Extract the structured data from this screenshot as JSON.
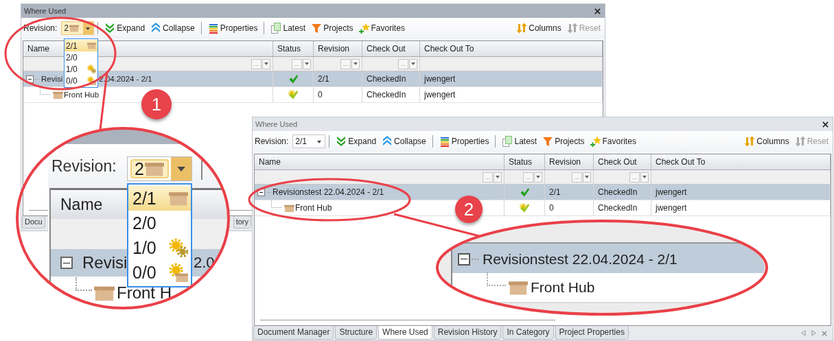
{
  "windows": [
    {
      "title": "Where Used",
      "active": true,
      "toolbar": {
        "revision_label": "Revision:",
        "combo": {
          "value": "2",
          "kind": "box",
          "open": true,
          "options": [
            {
              "label": "2/1",
              "kind": "box",
              "selected": true
            },
            {
              "label": "2/0",
              "kind": "plain",
              "selected": false
            },
            {
              "label": "1/0",
              "kind": "gear",
              "selected": false
            },
            {
              "label": "0/0",
              "kind": "gear-box",
              "selected": false
            }
          ]
        },
        "groups": [
          [
            {
              "label": "Expand",
              "kind": "expand",
              "disabled": false
            },
            {
              "label": "Collapse",
              "kind": "collapse",
              "disabled": false
            }
          ],
          [
            {
              "label": "Properties",
              "kind": "properties",
              "disabled": false
            }
          ],
          [
            {
              "label": "Latest",
              "kind": "latest",
              "disabled": false
            },
            {
              "label": "Projects",
              "kind": "projects",
              "disabled": false
            },
            {
              "label": "Favorites",
              "kind": "favorites",
              "disabled": false
            }
          ]
        ],
        "right": [
          {
            "label": "Columns",
            "kind": "columns",
            "disabled": false
          },
          {
            "label": "Reset",
            "kind": "reset",
            "disabled": true
          }
        ]
      },
      "columns": [
        {
          "label": "Name",
          "filter": "..."
        },
        {
          "label": "Status",
          "filter": "..."
        },
        {
          "label": "Revision",
          "filter": "..."
        },
        {
          "label": "Check Out",
          "filter": "..."
        },
        {
          "label": "Check Out To"
        }
      ],
      "rows": [
        {
          "name_parts": [
            "Revisi",
            "2.04.2024 - 2/1"
          ],
          "expanded": true,
          "selected": true,
          "status": {
            "kind": "ok"
          },
          "revision": "2/1",
          "check_out": "CheckedIn",
          "check_out_to": "jwengert",
          "children": [
            {
              "name_parts": [
                "Front Hub"
              ],
              "selected": false,
              "status": {
                "kind": "ok-gear"
              },
              "revision": "0",
              "check_out": "CheckedIn",
              "check_out_to": "jwengert"
            }
          ]
        }
      ],
      "tabs": [
        {
          "label": "Docu",
          "selected": false
        },
        {
          "label": "tory",
          "selected": false
        }
      ]
    },
    {
      "title": "Where Used",
      "active": false,
      "toolbar": {
        "revision_label": "Revision:",
        "combo": {
          "value": "2/1",
          "kind": "plain",
          "open": false
        },
        "groups": [
          [
            {
              "label": "Expand",
              "kind": "expand",
              "disabled": false
            },
            {
              "label": "Collapse",
              "kind": "collapse",
              "disabled": false
            }
          ],
          [
            {
              "label": "Properties",
              "kind": "properties",
              "disabled": false
            }
          ],
          [
            {
              "label": "Latest",
              "kind": "latest",
              "disabled": false
            },
            {
              "label": "Projects",
              "kind": "projects",
              "disabled": false
            },
            {
              "label": "Favorites",
              "kind": "favorites",
              "disabled": false
            }
          ]
        ],
        "right": [
          {
            "label": "Columns",
            "kind": "columns",
            "disabled": false
          },
          {
            "label": "Reset",
            "kind": "reset",
            "disabled": true
          }
        ]
      },
      "columns": [
        {
          "label": "Name",
          "filter": "..."
        },
        {
          "label": "Status",
          "filter": "..."
        },
        {
          "label": "Revision",
          "filter": "..."
        },
        {
          "label": "Check Out",
          "filter": "..."
        },
        {
          "label": "Check Out To"
        }
      ],
      "rows": [
        {
          "name_parts": [
            "Revisionstest 22.04.2024 - 2/1"
          ],
          "expanded": true,
          "selected": true,
          "status": {
            "kind": "ok"
          },
          "revision": "2/1",
          "check_out": "CheckedIn",
          "check_out_to": "jwengert",
          "children": [
            {
              "name_parts": [
                "Front Hub"
              ],
              "selected": false,
              "status": {
                "kind": "ok-gear"
              },
              "revision": "0",
              "check_out": "CheckedIn",
              "check_out_to": "jwengert"
            }
          ]
        }
      ],
      "tabs": [
        {
          "label": "Document Manager",
          "selected": false
        },
        {
          "label": "Structure",
          "selected": false
        },
        {
          "label": "Where Used",
          "selected": true
        },
        {
          "label": "Revision History",
          "selected": false
        },
        {
          "label": "In Category",
          "selected": false
        },
        {
          "label": "Project Properties",
          "selected": false
        }
      ]
    }
  ],
  "callouts": [
    {
      "badge": "1",
      "kind": "dropdown-zoom",
      "revision_label": "Revision:",
      "combo": {
        "value": "2",
        "kind": "box"
      },
      "header": "Name",
      "options": [
        {
          "label": "2/1",
          "kind": "box",
          "selected": true
        },
        {
          "label": "2/0",
          "kind": "plain",
          "selected": false
        },
        {
          "label": "1/0",
          "kind": "gear",
          "selected": false
        },
        {
          "label": "0/0",
          "kind": "gear-box",
          "selected": false
        }
      ],
      "row_parts": [
        "Revisi",
        "2.0"
      ],
      "child_text": "Front H"
    },
    {
      "badge": "2",
      "kind": "row-zoom",
      "row": "Revisionstest 22.04.2024 - 2/1",
      "child": "Front Hub"
    }
  ]
}
